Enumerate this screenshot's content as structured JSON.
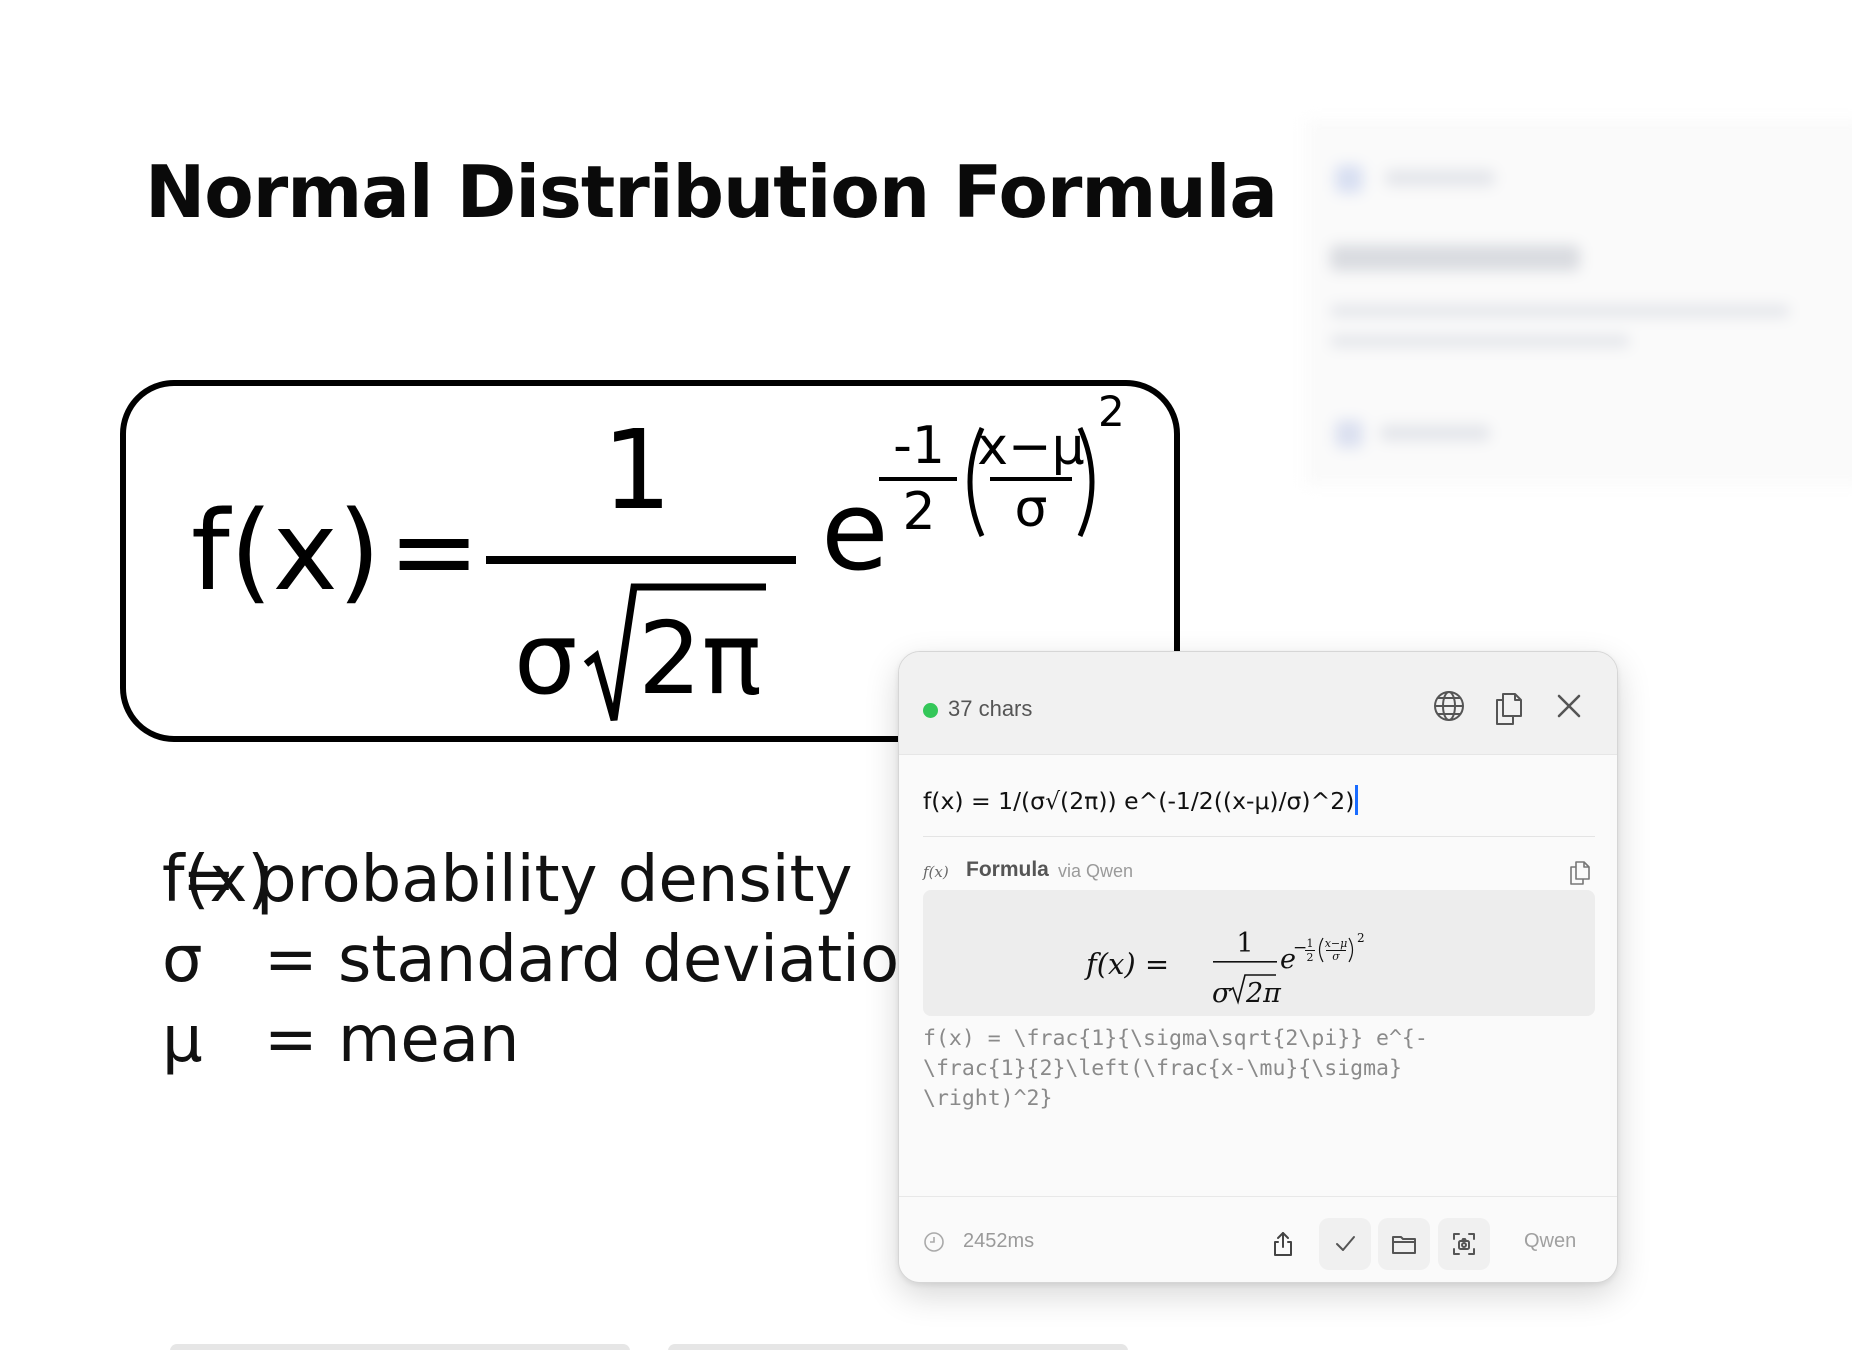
{
  "document": {
    "title": "Normal Distribution Formula",
    "formula": {
      "lhs": "f(x)",
      "equals": "=",
      "numerator": "1",
      "denominator_sigma": "σ",
      "denominator_radicand": "2π",
      "base": "e",
      "exponent_numerator": "-1",
      "exponent_denominator": "2",
      "inner_numerator": "x−μ",
      "inner_denominator": "σ",
      "power": "2"
    },
    "legend": [
      {
        "symbol": "f(x)",
        "text": "= probability density"
      },
      {
        "symbol": "σ",
        "text": "= standard deviation"
      },
      {
        "symbol": "μ",
        "text": "= mean"
      }
    ]
  },
  "popup": {
    "header": {
      "status_color": "#34c759",
      "char_count": "37 chars",
      "icons": [
        "globe-icon",
        "copy-icon",
        "close-icon"
      ]
    },
    "input_text": "f(x) = 1/(σ√(2π)) e^(-1/2((x-μ)/σ)^2)",
    "result": {
      "fx_icon": "f(x)",
      "title": "Formula",
      "via": "via Qwen",
      "rendered": {
        "lhs": "f(x) =",
        "num": "1",
        "den_sigma": "σ",
        "den_radicand": "2π",
        "base": "e",
        "exp_sign": "−",
        "exp_num": "1",
        "exp_den": "2",
        "inner_num": "x−μ",
        "inner_den": "σ",
        "power": "2"
      },
      "latex_lines": [
        "f(x) = \\frac{1}{\\sigma\\sqrt{2\\pi}} e^{-",
        "\\frac{1}{2}\\left(\\frac{x-\\mu}{\\sigma}",
        "\\right)^2}"
      ]
    },
    "footer": {
      "elapsed": "2452ms",
      "buttons": [
        "share-icon",
        "check-icon",
        "folder-icon",
        "screenshot-icon"
      ],
      "engine": "Qwen"
    }
  }
}
